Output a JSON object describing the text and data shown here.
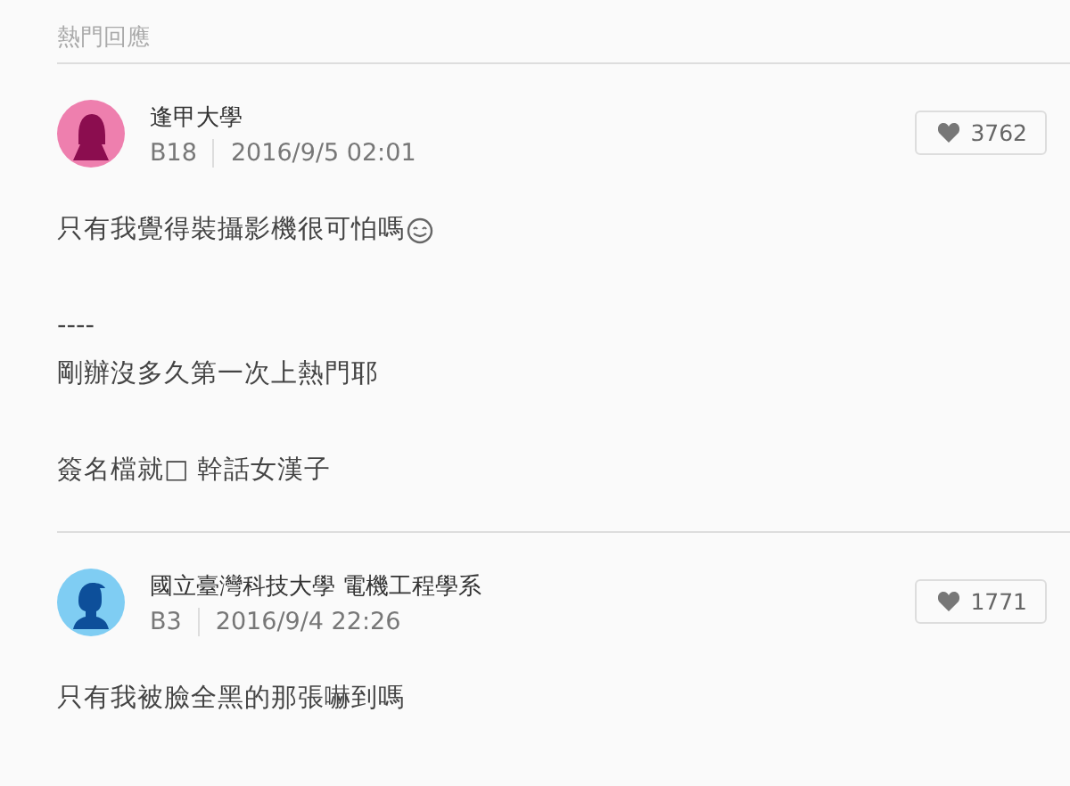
{
  "section_title": "熱門回應",
  "comments": [
    {
      "school": "逢甲大學",
      "floor": "B18",
      "time": "2016/9/5 02:01",
      "likes": "3762",
      "kind": "female",
      "color": "#ee7fae",
      "paragraphs": [
        {
          "lines": [
            "只有我覺得裝攝影機很可怕嗎"
          ],
          "emoji": true
        },
        {
          "lines": [
            "----",
            "剛辦沒多久第一次上熱門耶"
          ],
          "emoji": false
        },
        {
          "lines": [
            "簽名檔就□ 幹話女漢子"
          ],
          "emoji": false
        }
      ]
    },
    {
      "school": "國立臺灣科技大學 電機工程學系",
      "floor": "B3",
      "time": "2016/9/4 22:26",
      "likes": "1771",
      "kind": "male",
      "color": "#7fcdf3",
      "paragraphs": [
        {
          "lines": [
            "只有我被臉全黑的那張嚇到嗎"
          ],
          "emoji": false
        }
      ]
    }
  ]
}
